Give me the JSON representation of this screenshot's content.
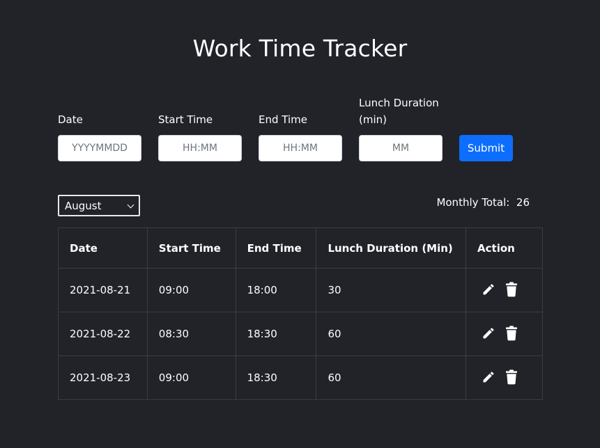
{
  "header": {
    "title": "Work Time Tracker"
  },
  "form": {
    "fields": [
      {
        "label": "Date",
        "placeholder": "YYYYMMDD"
      },
      {
        "label": "Start Time",
        "placeholder": "HH:MM"
      },
      {
        "label": "End Time",
        "placeholder": "HH:MM"
      },
      {
        "label": "Lunch Duration (min)",
        "placeholder": "MM"
      }
    ],
    "submit_label": "Submit"
  },
  "filter": {
    "selected_month": "August",
    "total_label": "Monthly Total:",
    "total_value": "26"
  },
  "table": {
    "headers": [
      "Date",
      "Start Time",
      "End Time",
      "Lunch Duration (Min)",
      "Action"
    ],
    "rows": [
      [
        "2021-08-21",
        "09:00",
        "18:00",
        "30"
      ],
      [
        "2021-08-22",
        "08:30",
        "18:30",
        "60"
      ],
      [
        "2021-08-23",
        "09:00",
        "18:30",
        "60"
      ]
    ],
    "action_icons": [
      "pencil-icon",
      "trash-icon"
    ]
  },
  "colors": {
    "background": "#212329",
    "accent": "#0d6efd",
    "border": "#3a3d44"
  }
}
